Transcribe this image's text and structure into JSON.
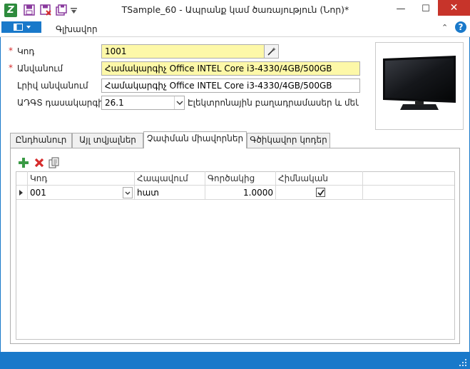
{
  "window": {
    "title": "TSample_60 - Ապրանք կամ ծառայություն (Նոր)*",
    "minimize_glyph": "—",
    "maximize_glyph": "☐",
    "close_glyph": "✕"
  },
  "ribbon": {
    "tab_main": "Գլխավոր",
    "help_glyph": "?",
    "collapse_glyph": "⌃"
  },
  "form": {
    "required_mark": "*",
    "code_label": "Կոդ",
    "code_value": "1001",
    "name_label": "Անվանում",
    "name_value": "Համակարգիչ Office INTEL Core i3-4330/4GB/500GB",
    "fullname_label": "Լրիվ անվանում",
    "fullname_value": "Համակարգիչ Office INTEL Core i3-4330/4GB/500GB",
    "classifier_label": "ԱԴԳՏ դասակարգիչ",
    "classifier_value": "26.1",
    "classifier_desc": "Էլեկտրոնային բաղադրամասեր և մեկուս"
  },
  "tabs": [
    {
      "label": "Ընդհանուր"
    },
    {
      "label": "Այլ տվյալներ"
    },
    {
      "label": "Չափման միավորներ"
    },
    {
      "label": "Գծիկավոր կոդեր"
    }
  ],
  "grid": {
    "columns": [
      "Կոդ",
      "Հապավում",
      "Գործակից",
      "Հիմնական"
    ],
    "rows": [
      {
        "code": "001",
        "abbr": "հատ",
        "coef": "1.0000",
        "main_checked": true
      }
    ]
  },
  "colors": {
    "accent": "#1979ca",
    "required": "#d62b2b",
    "highlight_field": "#fdf8a8",
    "close_button": "#c7342a"
  },
  "icons": {
    "add": "plus-icon",
    "delete": "delete-x-icon",
    "copy": "copy-icon",
    "picker": "wand-icon"
  }
}
